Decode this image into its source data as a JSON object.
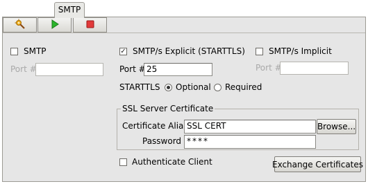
{
  "tab": {
    "label": "SMTP"
  },
  "toolbar": {
    "buttons": [
      {
        "icon": "settings-wand-icon"
      },
      {
        "icon": "play-icon"
      },
      {
        "icon": "stop-icon"
      }
    ]
  },
  "smtp": {
    "label": "SMTP",
    "checked": false,
    "port_label": "Port #",
    "port_value": ""
  },
  "explicit": {
    "label": "SMTP/s Explicit (STARTTLS)",
    "checked": true,
    "port_label": "Port #",
    "port_value": "25",
    "starttls_label": "STARTTLS",
    "options": [
      "Optional",
      "Required"
    ],
    "selected": "Optional"
  },
  "implicit": {
    "label": "SMTP/s Implicit",
    "checked": false,
    "port_label": "Port #",
    "port_value": ""
  },
  "ssl": {
    "title": "SSL Server Certificate",
    "alias_label": "Certificate Alias",
    "alias_value": "SSL CERT",
    "browse_label": "Browse...",
    "password_label": "Password",
    "password_value": "****"
  },
  "auth": {
    "label": "Authenticate Client",
    "checked": false
  },
  "exchange_button": "Exchange Certificates",
  "colors": {
    "panel_bg": "#e6e6e6",
    "play_green": "#2bb52b",
    "stop_red": "#e23a3a"
  }
}
